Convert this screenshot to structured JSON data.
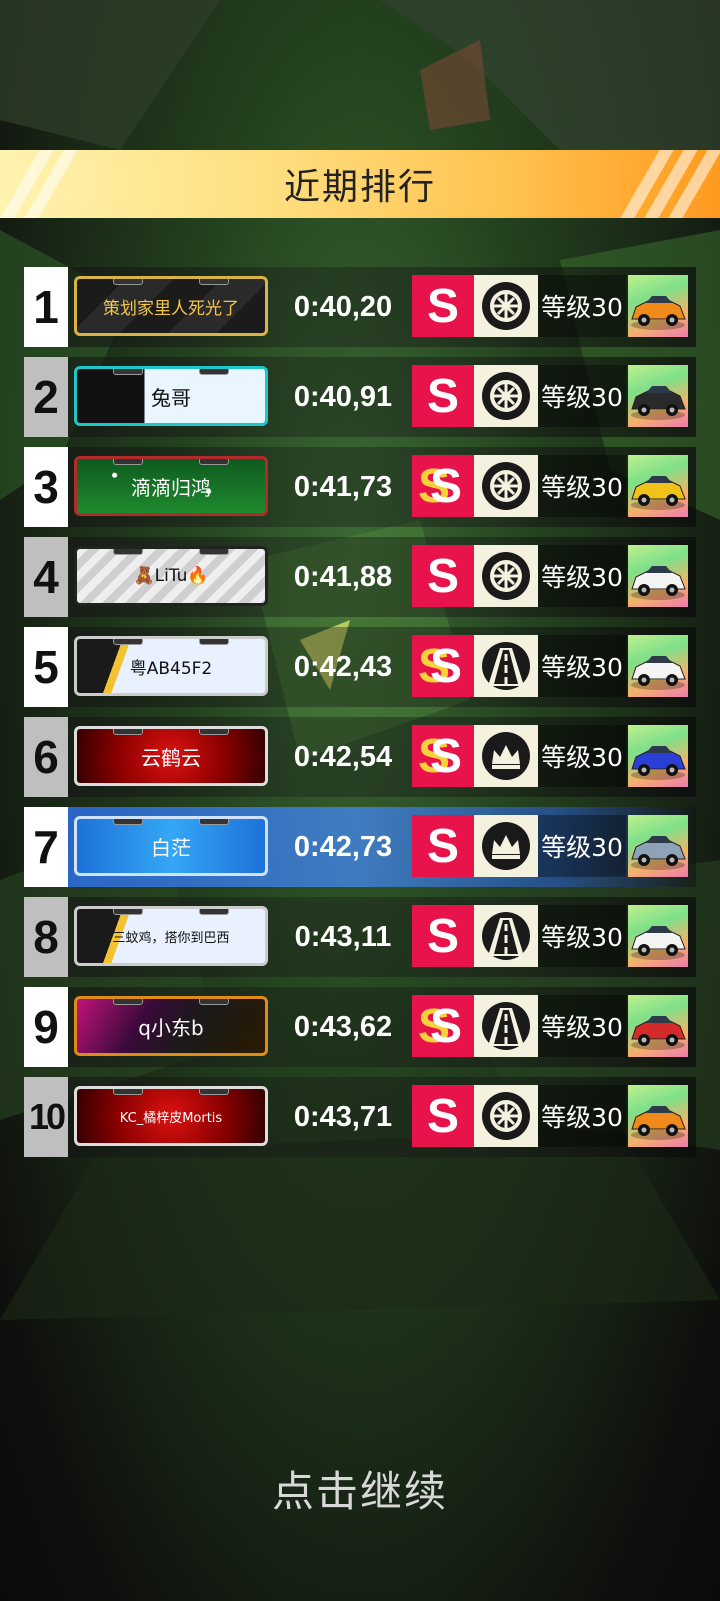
{
  "title": "近期排行",
  "continue_label": "点击继续",
  "colors": {
    "accent_orange": "#ff9a1f",
    "s_badge": "#e8134a",
    "highlight_blue": "#3f86ff"
  },
  "rows": [
    {
      "rank": "1",
      "name": "策划家里人死光了",
      "time": "0:40,20",
      "grade": "S",
      "icon": "tire-icon",
      "level": "等级30",
      "plate": "gold",
      "car": "orange",
      "highlight": false
    },
    {
      "rank": "2",
      "name": "兔哥",
      "time": "0:40,91",
      "grade": "S",
      "icon": "tire-icon",
      "level": "等级30",
      "plate": "tap",
      "car": "black",
      "highlight": false
    },
    {
      "rank": "3",
      "name": "滴滴归鸿",
      "time": "0:41,73",
      "grade": "SS",
      "icon": "tire-icon",
      "level": "等级30",
      "plate": "forest",
      "car": "yellow",
      "highlight": false
    },
    {
      "rank": "4",
      "name": "🧸LiTu🔥",
      "time": "0:41,88",
      "grade": "S",
      "icon": "tire-icon",
      "level": "等级30",
      "plate": "graffiti",
      "car": "white",
      "highlight": false
    },
    {
      "rank": "5",
      "name": "粤AB45F2",
      "time": "0:42,43",
      "grade": "SS",
      "icon": "road-icon",
      "level": "等级30",
      "plate": "star",
      "car": "white",
      "highlight": false
    },
    {
      "rank": "6",
      "name": "云鹤云",
      "time": "0:42,54",
      "grade": "SS",
      "icon": "crown-icon",
      "level": "等级30",
      "plate": "red",
      "car": "blue",
      "highlight": false
    },
    {
      "rank": "7",
      "name": "白茫",
      "time": "0:42,73",
      "grade": "S",
      "icon": "crown-icon",
      "level": "等级30",
      "plate": "blue",
      "car": "grey",
      "highlight": true
    },
    {
      "rank": "8",
      "name": "三蚊鸡，搭你到巴西",
      "time": "0:43,11",
      "grade": "S",
      "icon": "road-icon",
      "level": "等级30",
      "plate": "star",
      "car": "white",
      "highlight": false
    },
    {
      "rank": "9",
      "name": "q小东b",
      "time": "0:43,62",
      "grade": "SS",
      "icon": "road-icon",
      "level": "等级30",
      "plate": "dark",
      "car": "red",
      "highlight": false
    },
    {
      "rank": "10",
      "name": "KC_橘梓皮Mortis",
      "time": "0:43,71",
      "grade": "S",
      "icon": "tire-icon",
      "level": "等级30",
      "plate": "red",
      "car": "orange",
      "highlight": false
    }
  ]
}
